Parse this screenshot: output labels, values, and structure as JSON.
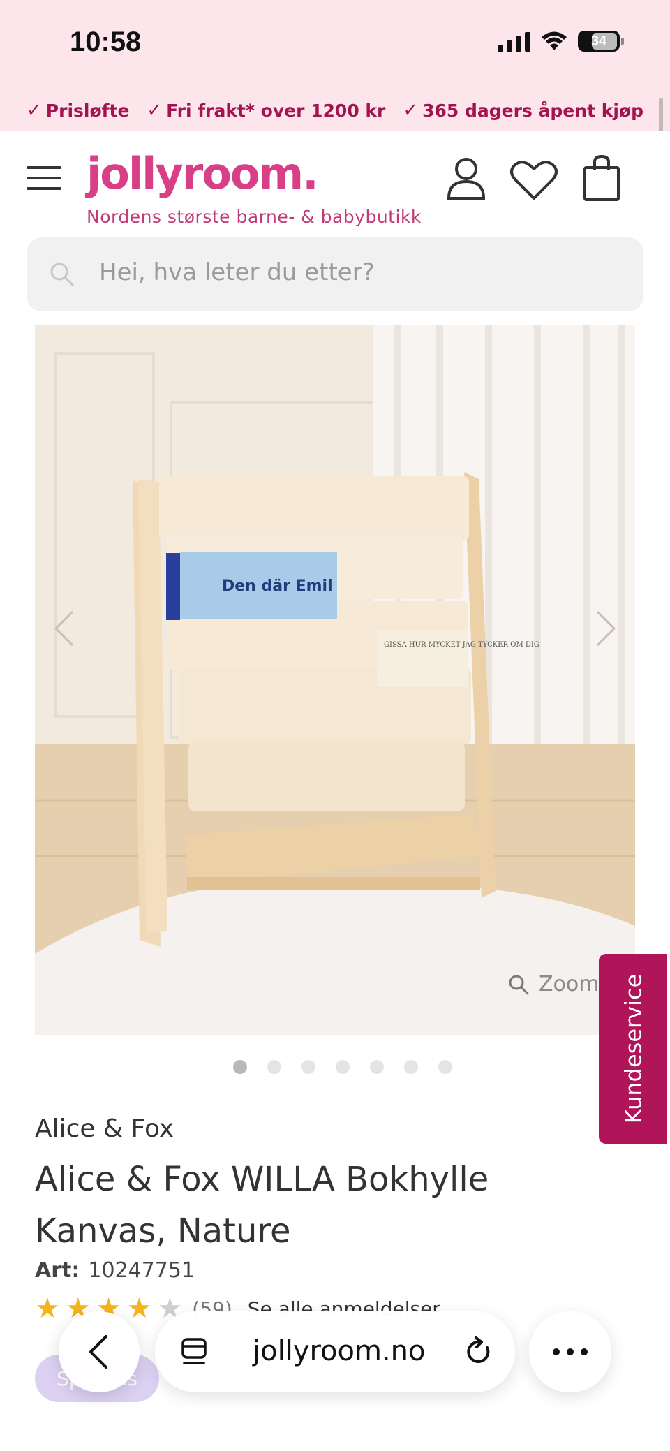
{
  "status_bar": {
    "time": "10:58",
    "battery": "34"
  },
  "promo": [
    {
      "label": "Prisløfte"
    },
    {
      "label": "Fri frakt* over 1200 kr"
    },
    {
      "label": "365 dagers åpent kjøp"
    }
  ],
  "header": {
    "logo": "jollyroom.",
    "tagline": "Nordens største barne- & babybutikk"
  },
  "search": {
    "placeholder": "Hei, hva leter du etter?"
  },
  "gallery": {
    "zoom_label": "Zoom",
    "slide_count": 7,
    "active_slide": 1,
    "book_title": "Den där Emil",
    "book_title_2": "GISSA HUR MYCKET JAG TYCKER OM DIG"
  },
  "kundeservice": "Kundeservice",
  "product": {
    "brand": "Alice & Fox",
    "title": "Alice & Fox WILLA Bokhylle Kanvas, Nature",
    "art_label": "Art:",
    "art_number": "10247751",
    "rating": 4,
    "rating_max": 5,
    "review_count": "(59)",
    "reviews_link": "Se alle anmeldelser",
    "chip_label": "Sparpris"
  },
  "browser": {
    "url": "jollyroom.no"
  },
  "colors": {
    "brand_pink": "#d93f86",
    "promo_bg": "#fce6ec",
    "kundeservice_bg": "#b0155a",
    "star": "#f3b51c"
  }
}
